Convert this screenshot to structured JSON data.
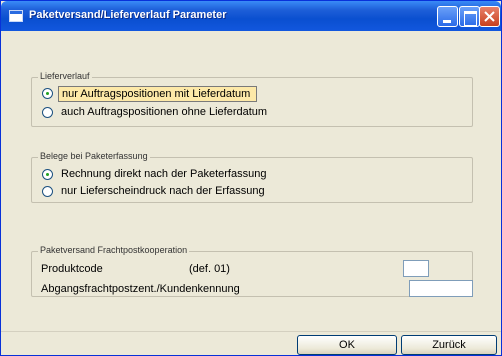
{
  "window": {
    "title": "Paketversand/Lieferverlauf Parameter"
  },
  "lieferverlauf": {
    "legend": "Lieferverlauf",
    "options": [
      {
        "label": "nur Auftragspositionen mit Lieferdatum",
        "checked": true
      },
      {
        "label": "auch Auftragspositionen ohne Lieferdatum",
        "checked": false
      }
    ]
  },
  "belege": {
    "legend": "Belege bei Paketerfassung",
    "options": [
      {
        "label": "Rechnung direkt nach der Paketerfassung",
        "checked": true
      },
      {
        "label": "nur Lieferscheindruck nach der Erfassung",
        "checked": false
      }
    ]
  },
  "paketversand": {
    "legend": "Paketversand Frachtpostkooperation",
    "produktcode_label": "Produktcode",
    "produktcode_default": "(def. 01)",
    "produktcode_value": "",
    "abgang_label": "Abgangsfrachtpostzent./Kundenkennung",
    "abgang_value": ""
  },
  "buttons": {
    "ok": "OK",
    "back": "Zurück"
  },
  "colors": {
    "titlebar": "#0a4fd0",
    "dialog_bg": "#ece9d8",
    "highlight": "#fde9a8"
  }
}
